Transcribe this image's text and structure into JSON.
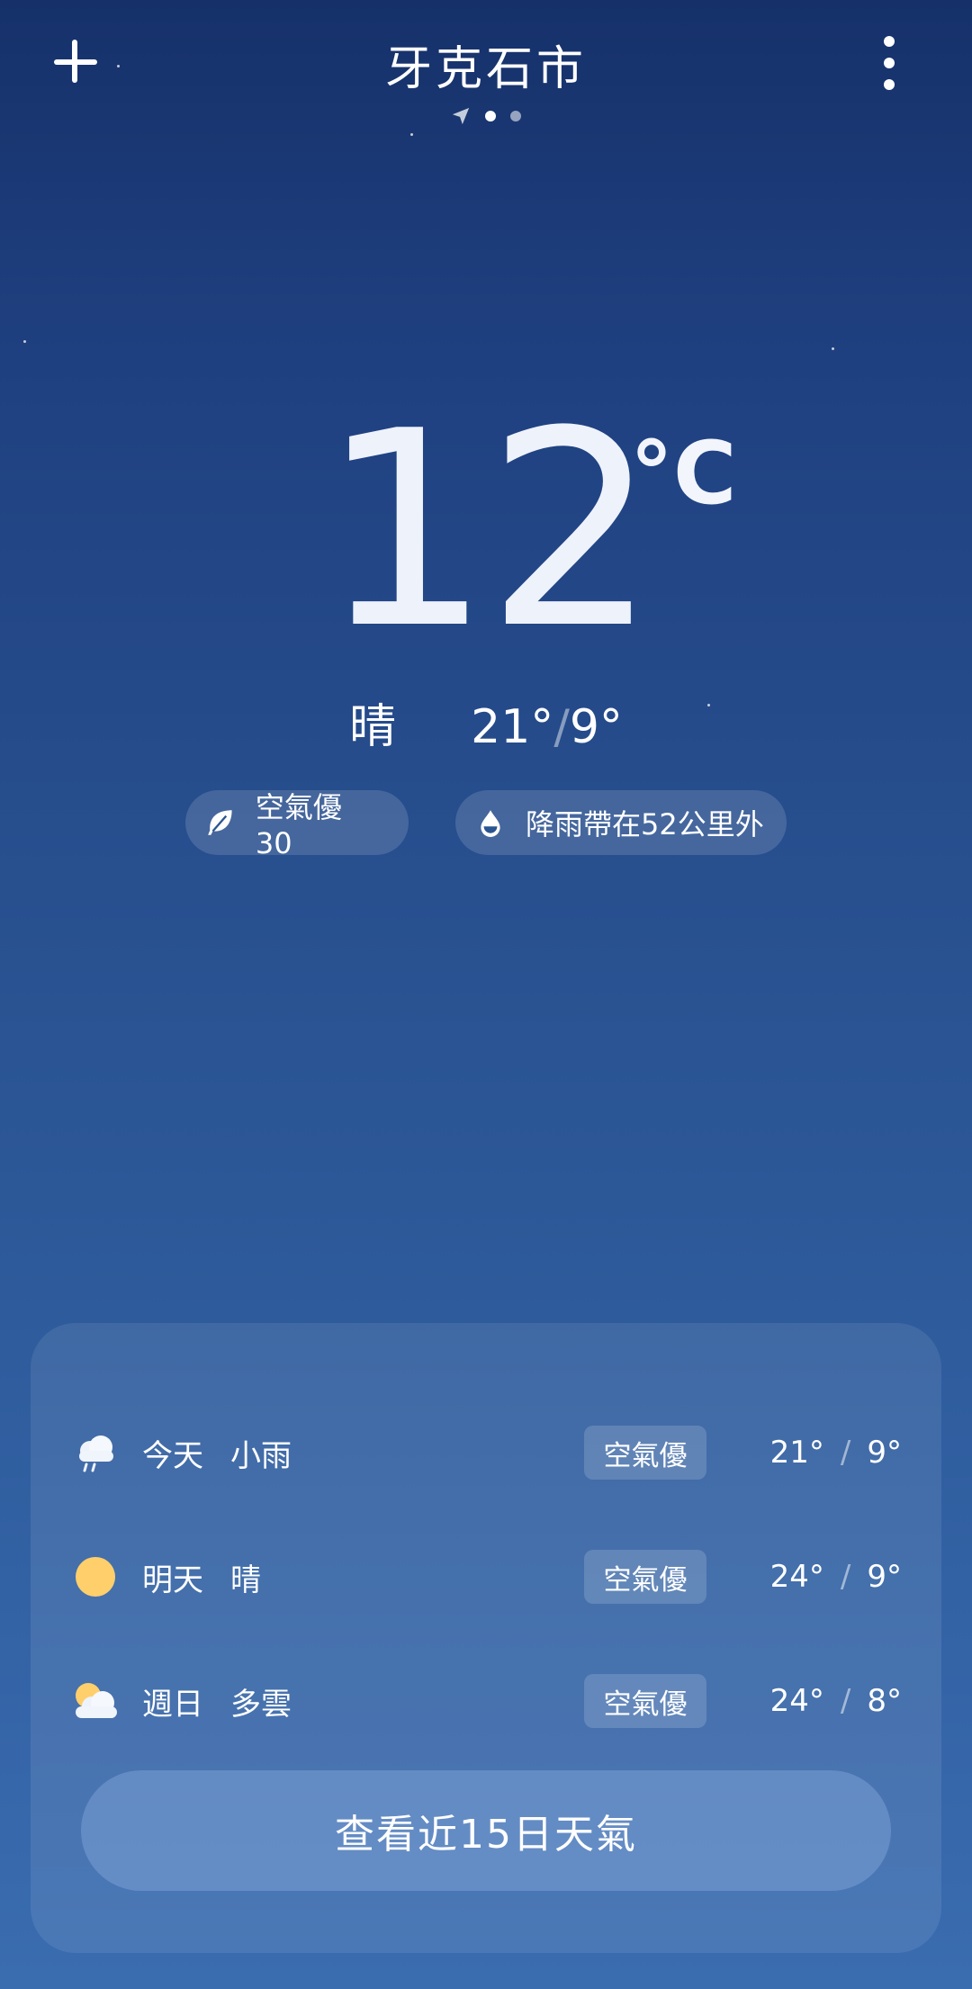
{
  "header": {
    "city": "牙克石市",
    "page_count": 3
  },
  "current": {
    "temperature": "12",
    "unit": "°C",
    "condition": "晴",
    "high": "21°",
    "low": "9°",
    "temp_separator": "/"
  },
  "badges": {
    "air_quality": "空氣優 30",
    "rain": "降雨帶在52公里外"
  },
  "forecast": [
    {
      "day": "今天",
      "condition": "小雨",
      "aqi": "空氣優",
      "high": "21°",
      "low": "9°",
      "icon": "rain-cloud-icon"
    },
    {
      "day": "明天",
      "condition": "晴",
      "aqi": "空氣優",
      "high": "24°",
      "low": "9°",
      "icon": "sun-icon"
    },
    {
      "day": "週日",
      "condition": "多雲",
      "aqi": "空氣優",
      "high": "24°",
      "low": "8°",
      "icon": "partly-cloudy-icon"
    }
  ],
  "cta": {
    "label": "查看近15日天氣"
  },
  "colors": {
    "background_top": "#16316a",
    "background_bottom": "#3a6cb0",
    "sun": "#ffcf6b"
  }
}
